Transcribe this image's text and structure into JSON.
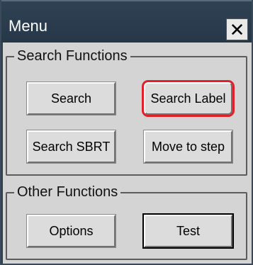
{
  "window": {
    "title": "Menu",
    "close_glyph": "✕"
  },
  "groups": {
    "search": {
      "label": "Search Functions",
      "buttons": {
        "search": "Search",
        "search_label": "Search Label",
        "search_sbrt": "Search SBRT",
        "move_to_step": "Move to step"
      }
    },
    "other": {
      "label": "Other Functions",
      "buttons": {
        "options": "Options",
        "test": "Test"
      }
    }
  },
  "colors": {
    "titlebar": "#2c3e4e",
    "panel": "#d4d4d4",
    "highlight": "#e0202a"
  }
}
